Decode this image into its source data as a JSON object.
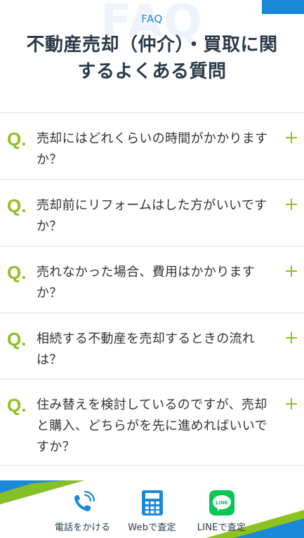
{
  "header": {
    "watermark": "FAQ",
    "eyebrow": "FAQ",
    "title": "不動産売却（仲介）・買取に関するよくある質問"
  },
  "faq": {
    "q_mark": "Q.",
    "items": [
      {
        "question": "売却にはどれくらいの時間がかかりますか？"
      },
      {
        "question": "売却前にリフォームはした方がいいですか？"
      },
      {
        "question": "売れなかった場合、費用はかかりますか？"
      },
      {
        "question": "相続する不動産を売却するときの流れは？"
      },
      {
        "question": "住み替えを検討しているのですが、売却と購入、どちらがを先に進めればいいですか？"
      }
    ]
  },
  "footer": {
    "buttons": [
      {
        "label": "電話をかける",
        "icon": "phone-icon"
      },
      {
        "label": "Webで査定",
        "icon": "calculator-icon"
      },
      {
        "label": "LINEで査定",
        "icon": "line-icon",
        "icon_text": "LINE"
      }
    ]
  },
  "colors": {
    "accent_blue": "#1a8ad8",
    "accent_green": "#8dc21f",
    "line_green": "#06c755",
    "title": "#2b3a4a"
  }
}
